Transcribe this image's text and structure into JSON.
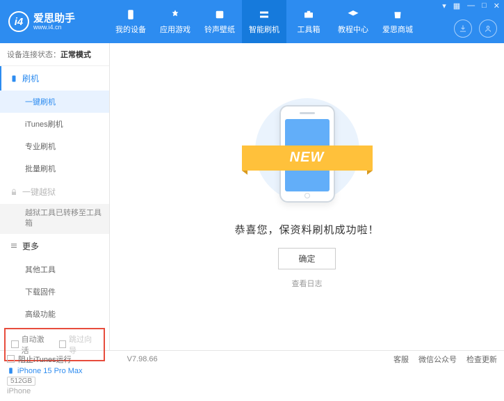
{
  "header": {
    "logo_title": "爱思助手",
    "logo_sub": "www.i4.cn",
    "nav": [
      {
        "label": "我的设备"
      },
      {
        "label": "应用游戏"
      },
      {
        "label": "铃声壁纸"
      },
      {
        "label": "智能刷机"
      },
      {
        "label": "工具箱"
      },
      {
        "label": "教程中心"
      },
      {
        "label": "爱思商城"
      }
    ]
  },
  "status": {
    "prefix": "设备连接状态：",
    "mode": "正常模式"
  },
  "sidebar": {
    "flash_header": "刷机",
    "flash_items": [
      "一键刷机",
      "iTunes刷机",
      "专业刷机",
      "批量刷机"
    ],
    "jailbreak_header": "一键越狱",
    "jailbreak_info": "越狱工具已转移至工具箱",
    "more_header": "更多",
    "more_items": [
      "其他工具",
      "下载固件",
      "高级功能"
    ],
    "checkbox1": "自动激活",
    "checkbox2": "跳过向导"
  },
  "device": {
    "name": "iPhone 15 Pro Max",
    "capacity": "512GB",
    "type": "iPhone"
  },
  "main": {
    "ribbon": "NEW",
    "success": "恭喜您，保资料刷机成功啦！",
    "ok": "确定",
    "log": "查看日志"
  },
  "footer": {
    "block_itunes": "阻止iTunes运行",
    "version": "V7.98.66",
    "links": [
      "客服",
      "微信公众号",
      "检查更新"
    ]
  }
}
